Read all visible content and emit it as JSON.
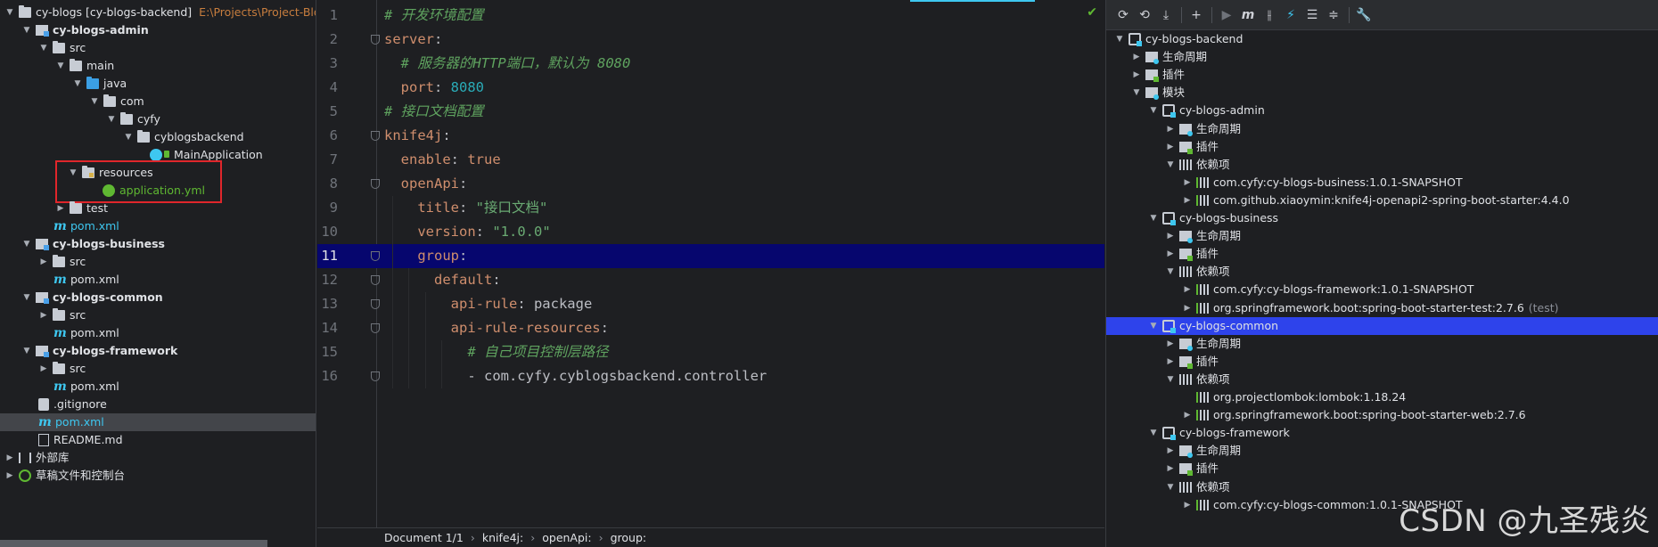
{
  "project_tree": {
    "root": {
      "label": "cy-blogs [cy-blogs-backend]",
      "path": "E:\\Projects\\Project-Blog"
    },
    "items": [
      {
        "label": "cy-blogs-admin"
      },
      {
        "label": "src"
      },
      {
        "label": "main"
      },
      {
        "label": "java"
      },
      {
        "label": "com"
      },
      {
        "label": "cyfy"
      },
      {
        "label": "cyblogsbackend"
      },
      {
        "label": "MainApplication"
      },
      {
        "label": "resources"
      },
      {
        "label": "application.yml"
      },
      {
        "label": "test"
      },
      {
        "label": "pom.xml"
      },
      {
        "label": "cy-blogs-business"
      },
      {
        "label": "src"
      },
      {
        "label": "pom.xml"
      },
      {
        "label": "cy-blogs-common"
      },
      {
        "label": "src"
      },
      {
        "label": "pom.xml"
      },
      {
        "label": "cy-blogs-framework"
      },
      {
        "label": "src"
      },
      {
        "label": "pom.xml"
      },
      {
        "label": ".gitignore"
      },
      {
        "label": "pom.xml"
      },
      {
        "label": "README.md"
      },
      {
        "label": "外部库"
      },
      {
        "label": "草稿文件和控制台"
      }
    ]
  },
  "editor": {
    "lines": [
      {
        "n": "1",
        "parts": [
          {
            "t": "# 开发环境配置",
            "c": "comment"
          }
        ]
      },
      {
        "n": "2",
        "parts": [
          {
            "t": "server",
            "c": "key"
          },
          {
            "t": ":",
            "c": "plain"
          }
        ]
      },
      {
        "n": "3",
        "parts": [
          {
            "t": "  ",
            "c": "plain"
          },
          {
            "t": "# 服务器的HTTP端口，默认为 8080",
            "c": "comment"
          }
        ]
      },
      {
        "n": "4",
        "parts": [
          {
            "t": "  port",
            "c": "key"
          },
          {
            "t": ": ",
            "c": "plain"
          },
          {
            "t": "8080",
            "c": "num"
          }
        ]
      },
      {
        "n": "5",
        "parts": [
          {
            "t": "# 接口文档配置",
            "c": "comment"
          }
        ]
      },
      {
        "n": "6",
        "parts": [
          {
            "t": "knife4j",
            "c": "key"
          },
          {
            "t": ":",
            "c": "plain"
          }
        ]
      },
      {
        "n": "7",
        "parts": [
          {
            "t": "  enable",
            "c": "key"
          },
          {
            "t": ": ",
            "c": "plain"
          },
          {
            "t": "true",
            "c": "key"
          }
        ]
      },
      {
        "n": "8",
        "parts": [
          {
            "t": "  openApi",
            "c": "key"
          },
          {
            "t": ":",
            "c": "plain"
          }
        ]
      },
      {
        "n": "9",
        "parts": [
          {
            "t": "    title",
            "c": "key"
          },
          {
            "t": ": ",
            "c": "plain"
          },
          {
            "t": "\"接口文档\"",
            "c": "str"
          }
        ]
      },
      {
        "n": "10",
        "parts": [
          {
            "t": "    version",
            "c": "key"
          },
          {
            "t": ": ",
            "c": "plain"
          },
          {
            "t": "\"1.0.0\"",
            "c": "str"
          }
        ]
      },
      {
        "n": "11",
        "parts": [
          {
            "t": "    group",
            "c": "key"
          },
          {
            "t": ":",
            "c": "plain"
          }
        ]
      },
      {
        "n": "12",
        "parts": [
          {
            "t": "      default",
            "c": "key"
          },
          {
            "t": ":",
            "c": "plain"
          }
        ]
      },
      {
        "n": "13",
        "parts": [
          {
            "t": "        api-rule",
            "c": "key"
          },
          {
            "t": ": package",
            "c": "plain"
          }
        ]
      },
      {
        "n": "14",
        "parts": [
          {
            "t": "        api-rule-resources",
            "c": "key"
          },
          {
            "t": ":",
            "c": "plain"
          }
        ]
      },
      {
        "n": "15",
        "parts": [
          {
            "t": "          ",
            "c": "plain"
          },
          {
            "t": "# 自己项目控制层路径",
            "c": "comment"
          }
        ]
      },
      {
        "n": "16",
        "parts": [
          {
            "t": "          - com.cyfy.cyblogsbackend.controller",
            "c": "plain"
          }
        ]
      }
    ],
    "breadcrumb": [
      "Document 1/1",
      "knife4j:",
      "openApi:",
      "group:"
    ]
  },
  "maven": {
    "rows": [
      {
        "label": "cy-blogs-backend"
      },
      {
        "label": "生命周期"
      },
      {
        "label": "插件"
      },
      {
        "label": "模块"
      },
      {
        "label": "cy-blogs-admin"
      },
      {
        "label": "生命周期"
      },
      {
        "label": "插件"
      },
      {
        "label": "依赖项"
      },
      {
        "label": "com.cyfy:cy-blogs-business:1.0.1-SNAPSHOT"
      },
      {
        "label": "com.github.xiaoymin:knife4j-openapi2-spring-boot-starter:4.4.0"
      },
      {
        "label": "cy-blogs-business"
      },
      {
        "label": "生命周期"
      },
      {
        "label": "插件"
      },
      {
        "label": "依赖项"
      },
      {
        "label": "com.cyfy:cy-blogs-framework:1.0.1-SNAPSHOT"
      },
      {
        "label": "org.springframework.boot:spring-boot-starter-test:2.7.6",
        "scope": "(test)"
      },
      {
        "label": "cy-blogs-common"
      },
      {
        "label": "生命周期"
      },
      {
        "label": "插件"
      },
      {
        "label": "依赖项"
      },
      {
        "label": "org.projectlombok:lombok:1.18.24"
      },
      {
        "label": "org.springframework.boot:spring-boot-starter-web:2.7.6"
      },
      {
        "label": "cy-blogs-framework"
      },
      {
        "label": "生命周期"
      },
      {
        "label": "插件"
      },
      {
        "label": "依赖项"
      },
      {
        "label": "com.cyfy:cy-blogs-common:1.0.1-SNAPSHOT"
      }
    ]
  },
  "watermark": "CSDN @九圣残炎",
  "colors": {
    "accent": "#3ec7f0",
    "active_line": "#06066e",
    "selected_row": "#2e43eb",
    "highlight_box": "#e0262b"
  }
}
